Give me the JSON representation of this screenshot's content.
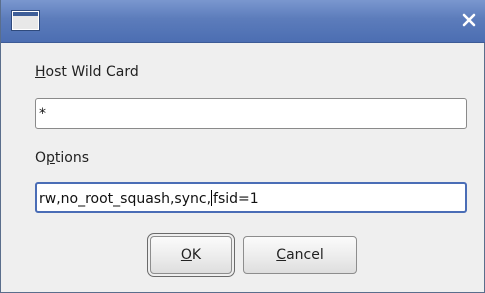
{
  "window": {
    "icon": "window-icon",
    "close_icon": "close-icon"
  },
  "host_wildcard": {
    "label_mnemonic": "H",
    "label_rest": "ost Wild Card",
    "value": "*"
  },
  "options": {
    "label_pre": "O",
    "label_mnemonic": "p",
    "label_rest": "tions",
    "value_before_caret": "rw,no_root_squash,sync,",
    "value_after_caret": "fsid=1"
  },
  "buttons": {
    "ok_mnemonic": "O",
    "ok_rest": "K",
    "cancel_mnemonic": "C",
    "cancel_rest": "ancel"
  }
}
